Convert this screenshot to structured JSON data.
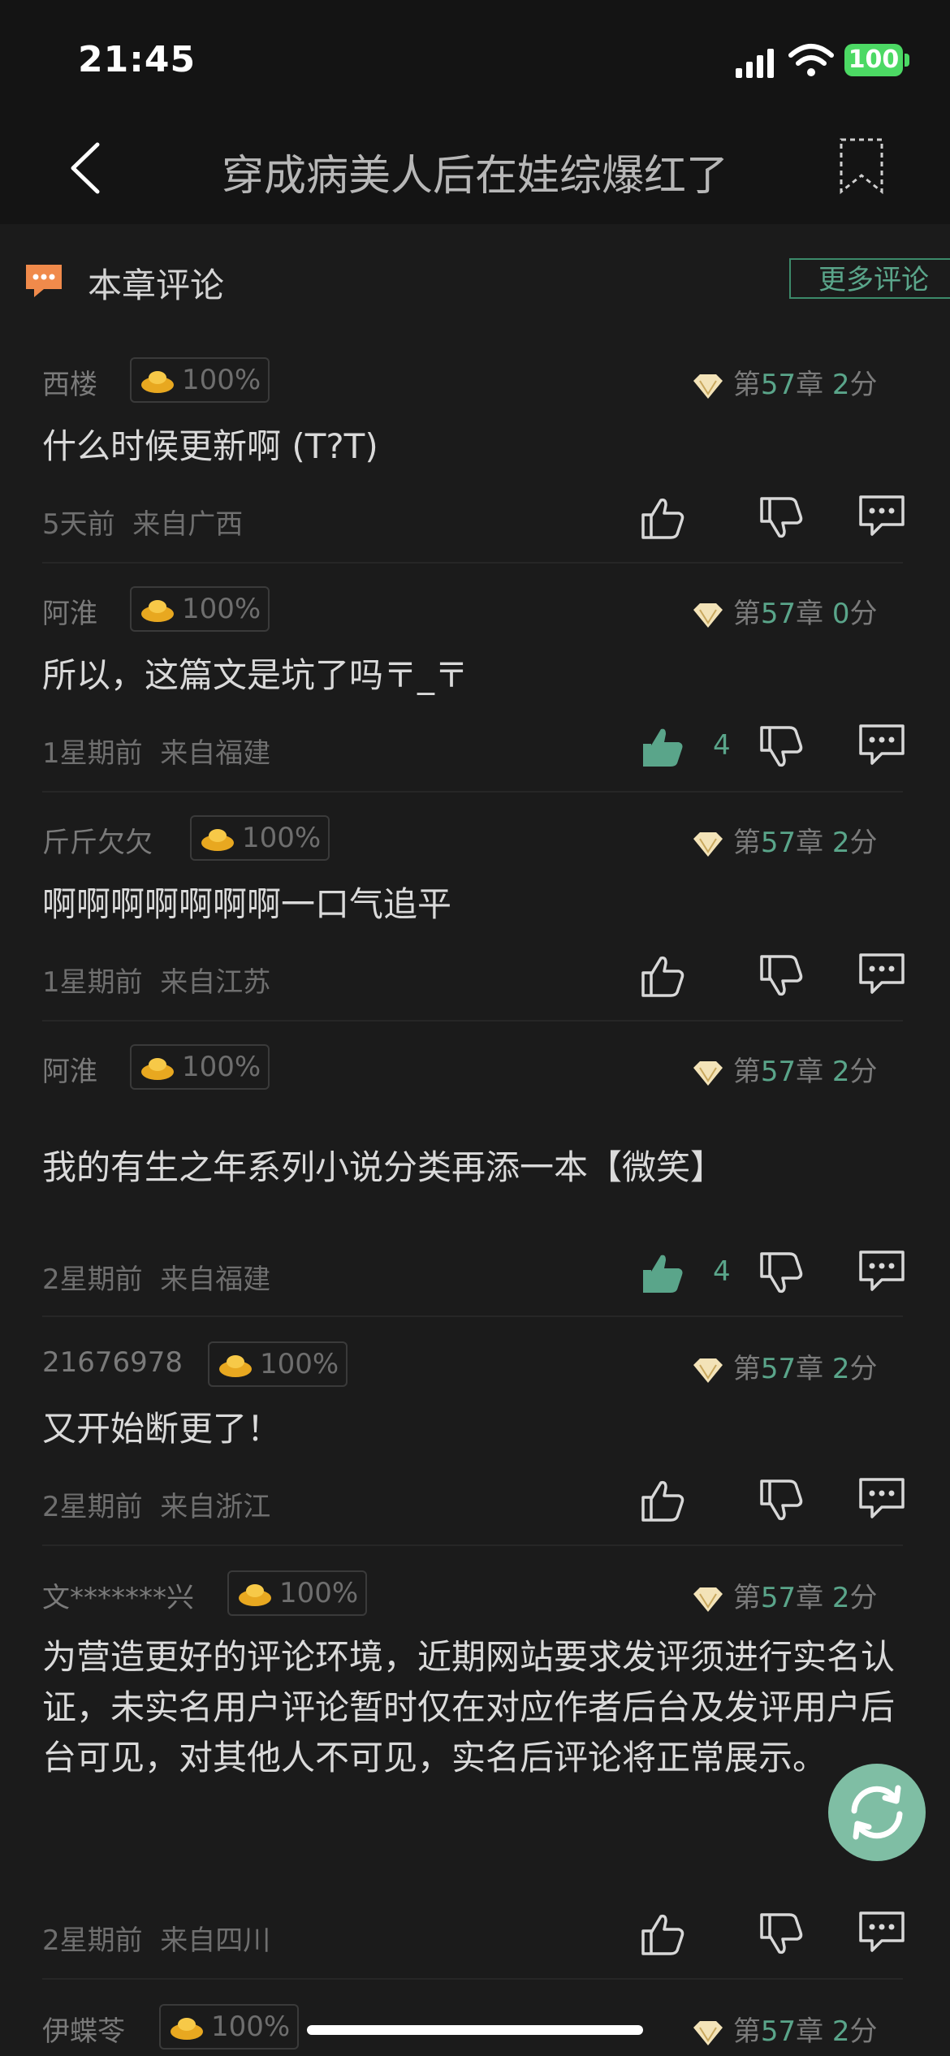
{
  "status": {
    "time": "21:45",
    "battery": "100"
  },
  "nav": {
    "title": "穿成病美人后在娃综爆红了"
  },
  "section": {
    "title": "本章评论",
    "more": "更多评论"
  },
  "comments": [
    {
      "user": "西楼",
      "badge": "100%",
      "chapter_prefix": "第",
      "chapter": "57",
      "chapter_suffix": "章",
      "score": "2",
      "score_unit": "分",
      "text": "什么时候更新啊 (T?T)",
      "time": "5天前",
      "location": "来自广西",
      "likes": "",
      "liked": false
    },
    {
      "user": "阿淮",
      "badge": "100%",
      "chapter_prefix": "第",
      "chapter": "57",
      "chapter_suffix": "章",
      "score": "0",
      "score_unit": "分",
      "text": "所以，这篇文是坑了吗〒_〒",
      "time": "1星期前",
      "location": "来自福建",
      "likes": "4",
      "liked": true
    },
    {
      "user": "斤斤欠欠",
      "badge": "100%",
      "chapter_prefix": "第",
      "chapter": "57",
      "chapter_suffix": "章",
      "score": "2",
      "score_unit": "分",
      "text": "啊啊啊啊啊啊啊一口气追平",
      "time": "1星期前",
      "location": "来自江苏",
      "likes": "",
      "liked": false
    },
    {
      "user": "阿淮",
      "badge": "100%",
      "chapter_prefix": "第",
      "chapter": "57",
      "chapter_suffix": "章",
      "score": "2",
      "score_unit": "分",
      "text": "我的有生之年系列小说分类再添一本【微笑】",
      "time": "2星期前",
      "location": "来自福建",
      "likes": "4",
      "liked": true
    },
    {
      "user": "21676978",
      "badge": "100%",
      "chapter_prefix": "第",
      "chapter": "57",
      "chapter_suffix": "章",
      "score": "2",
      "score_unit": "分",
      "text": "又开始断更了！",
      "time": "2星期前",
      "location": "来自浙江",
      "likes": "",
      "liked": false
    },
    {
      "user": "文*******兴",
      "badge": "100%",
      "chapter_prefix": "第",
      "chapter": "57",
      "chapter_suffix": "章",
      "score": "2",
      "score_unit": "分",
      "text": "为营造更好的评论环境，近期网站要求发评须进行实名认证，未实名用户评论暂时仅在对应作者后台及发评用户后台可见，对其他人不可见，实名后评论将正常展示。",
      "time": "2星期前",
      "location": "来自四川",
      "likes": "",
      "liked": false
    },
    {
      "user": "伊蝶苓",
      "badge": "100%",
      "chapter_prefix": "第",
      "chapter": "57",
      "chapter_suffix": "章",
      "score": "2",
      "score_unit": "分"
    }
  ],
  "colors": {
    "accent": "#5aa58a",
    "background": "#1b1b1b",
    "header": "#141414",
    "fab": "#7fbea4",
    "section_icon": "#f08a4b"
  }
}
